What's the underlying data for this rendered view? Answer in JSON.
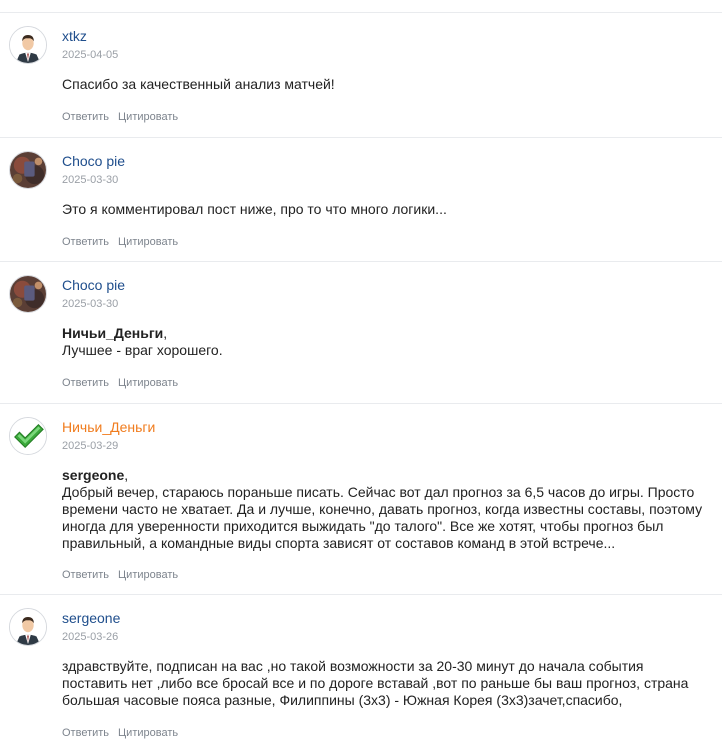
{
  "actions": {
    "reply_label": "Ответить",
    "quote_label": "Цитировать"
  },
  "comments": [
    {
      "author": "xtkz",
      "author_color": "#1f4e8c",
      "avatar_icon": "businessman-avatar-icon",
      "date": "2025-04-05",
      "quote_to": "",
      "text": "Спасибо за качественный анализ матчей!"
    },
    {
      "author": "Choco pie",
      "author_color": "#1f4e8c",
      "avatar_icon": "photo-avatar-icon",
      "date": "2025-03-30",
      "quote_to": "",
      "text": "Это я комментировал пост ниже, про то что много логики..."
    },
    {
      "author": "Choco pie",
      "author_color": "#1f4e8c",
      "avatar_icon": "photo-avatar-icon",
      "date": "2025-03-30",
      "quote_to": "Ничьи_Деньги",
      "text": "Лучшее - враг хорошего."
    },
    {
      "author": "Ничьи_Деньги",
      "author_color": "#f07c1e",
      "avatar_icon": "checkmark-avatar-icon",
      "date": "2025-03-29",
      "quote_to": "sergeone",
      "text": "Добрый вечер, стараюсь пораньше писать. Сейчас вот дал прогноз за 6,5 часов до игры. Просто времени часто не хватает. Да и лучше, конечно, давать прогноз, когда известны составы, поэтому иногда для уверенности приходится выжидать \"до талого\". Все же хотят, чтобы прогноз был правильный, а командные виды спорта зависят от составов команд в этой встрече..."
    },
    {
      "author": "sergeone",
      "author_color": "#1f4e8c",
      "avatar_icon": "businessman-avatar-icon",
      "date": "2025-03-26",
      "quote_to": "",
      "text": "здравствуйте, подписан на вас ,но такой возможности за 20-30 минут до начала события поставить нет ,либо все бросай все и по дороге вставай ,вот по раньше бы ваш прогноз, страна большая часовые пояса разные, Филиппины (3х3) - Южная Корея (3х3)зачет,спасибо,"
    }
  ]
}
